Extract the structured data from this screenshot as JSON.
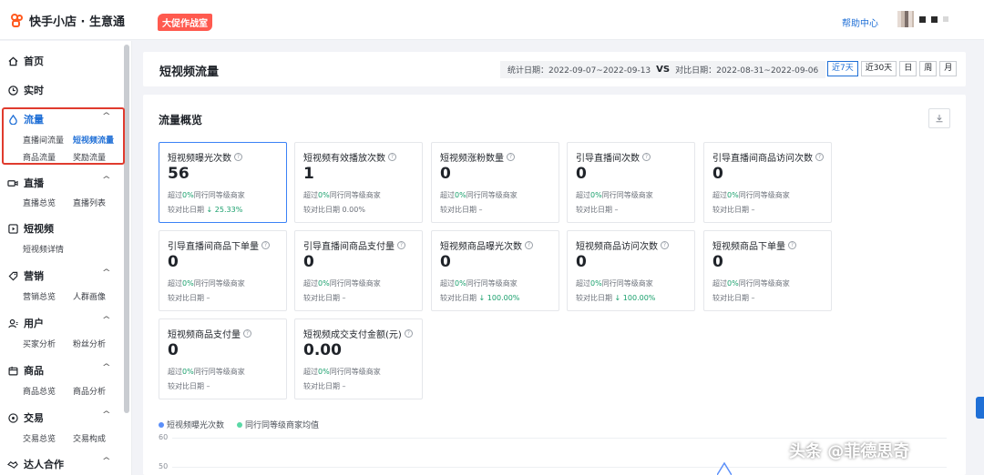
{
  "topbar": {
    "logo_text": "快手小店 · 生意通",
    "promo_badge": "大促作战室",
    "help_link": "帮助中心"
  },
  "sidebar": {
    "groups": [
      {
        "label": "首页",
        "icon": "home-icon",
        "items": []
      },
      {
        "label": "实时",
        "icon": "clock-icon",
        "items": []
      },
      {
        "label": "流量",
        "icon": "drop-icon",
        "items": [
          "直播间流量",
          "短视频流量",
          "商品流量",
          "奖励流量"
        ],
        "active_item": "短视频流量"
      },
      {
        "label": "直播",
        "icon": "camera-icon",
        "items": [
          "直播总览",
          "直播列表"
        ]
      },
      {
        "label": "短视频",
        "icon": "play-icon",
        "items": [
          "短视频详情"
        ]
      },
      {
        "label": "营销",
        "icon": "tag-icon",
        "items": [
          "营销总览",
          "人群画像"
        ]
      },
      {
        "label": "用户",
        "icon": "user-icon",
        "items": [
          "买家分析",
          "粉丝分析"
        ]
      },
      {
        "label": "商品",
        "icon": "box-icon",
        "items": [
          "商品总览",
          "商品分析"
        ]
      },
      {
        "label": "交易",
        "icon": "coin-icon",
        "items": [
          "交易总览",
          "交易构成"
        ]
      },
      {
        "label": "达人合作",
        "icon": "handshake-icon",
        "items": []
      }
    ]
  },
  "header": {
    "title": "短视频流量",
    "stat_date_label": "统计日期：2022-09-07~2022-09-13",
    "vs": "VS",
    "compare_date_label": "对比日期：2022-08-31~2022-09-06",
    "ranges": [
      "近7天",
      "近30天",
      "日",
      "周",
      "月"
    ],
    "active_range": "近7天"
  },
  "overview": {
    "title": "流量概览",
    "metrics": [
      {
        "label": "短视频曝光次数",
        "value": "56",
        "exceed_prefix": "超过",
        "exceed_pct": "0%",
        "exceed_suffix": "同行同等级商家",
        "compare": "较对比日期",
        "change": "↓ 25.33%"
      },
      {
        "label": "短视频有效播放次数",
        "value": "1",
        "exceed_prefix": "超过",
        "exceed_pct": "0%",
        "exceed_suffix": "同行同等级商家",
        "compare": "较对比日期 0.00%",
        "change": ""
      },
      {
        "label": "短视频涨粉数量",
        "value": "0",
        "exceed_prefix": "超过",
        "exceed_pct": "0%",
        "exceed_suffix": "同行同等级商家",
        "compare": "较对比日期 –",
        "change": ""
      },
      {
        "label": "引导直播间次数",
        "value": "0",
        "exceed_prefix": "超过",
        "exceed_pct": "0%",
        "exceed_suffix": "同行同等级商家",
        "compare": "较对比日期 –",
        "change": ""
      },
      {
        "label": "引导直播间商品访问次数",
        "value": "0",
        "exceed_prefix": "超过",
        "exceed_pct": "0%",
        "exceed_suffix": "同行同等级商家",
        "compare": "较对比日期 –",
        "change": ""
      },
      {
        "label": "引导直播间商品下单量",
        "value": "0",
        "exceed_prefix": "超过",
        "exceed_pct": "0%",
        "exceed_suffix": "同行同等级商家",
        "compare": "较对比日期 –",
        "change": ""
      },
      {
        "label": "引导直播间商品支付量",
        "value": "0",
        "exceed_prefix": "超过",
        "exceed_pct": "0%",
        "exceed_suffix": "同行同等级商家",
        "compare": "较对比日期 –",
        "change": ""
      },
      {
        "label": "短视频商品曝光次数",
        "value": "0",
        "exceed_prefix": "超过",
        "exceed_pct": "0%",
        "exceed_suffix": "同行同等级商家",
        "compare": "较对比日期",
        "change": "↓ 100.00%"
      },
      {
        "label": "短视频商品访问次数",
        "value": "0",
        "exceed_prefix": "超过",
        "exceed_pct": "0%",
        "exceed_suffix": "同行同等级商家",
        "compare": "较对比日期",
        "change": "↓ 100.00%"
      },
      {
        "label": "短视频商品下单量",
        "value": "0",
        "exceed_prefix": "超过",
        "exceed_pct": "0%",
        "exceed_suffix": "同行同等级商家",
        "compare": "较对比日期 –",
        "change": ""
      },
      {
        "label": "短视频商品支付量",
        "value": "0",
        "exceed_prefix": "超过",
        "exceed_pct": "0%",
        "exceed_suffix": "同行同等级商家",
        "compare": "较对比日期 –",
        "change": ""
      },
      {
        "label": "短视频成交支付金额(元)",
        "value": "0.00",
        "exceed_prefix": "超过",
        "exceed_pct": "0%",
        "exceed_suffix": "同行同等级商家",
        "compare": "较对比日期 –",
        "change": ""
      }
    ],
    "legend": [
      {
        "name": "短视频曝光次数",
        "color": "#5b8ff9"
      },
      {
        "name": "同行同等级商家均值",
        "color": "#5ad8a6"
      }
    ],
    "y_ticks": [
      "60",
      "50"
    ]
  },
  "watermark": "头条 @菲德思奇"
}
